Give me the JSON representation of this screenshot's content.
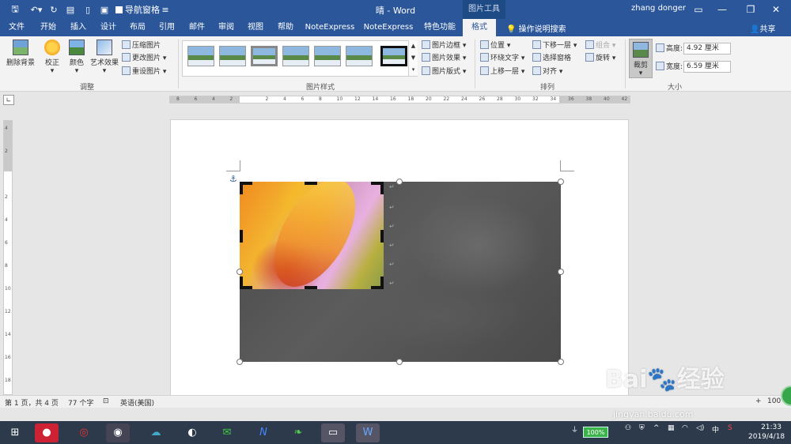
{
  "titlebar": {
    "nav_pane": "导航窗格",
    "title": "晴 - Word",
    "picture_tools": "图片工具",
    "user": "zhang donger"
  },
  "tabs": [
    "文件",
    "开始",
    "插入",
    "设计",
    "布局",
    "引用",
    "邮件",
    "审阅",
    "视图",
    "帮助",
    "NoteExpress",
    "NoteExpress",
    "特色功能",
    "格式"
  ],
  "tell_me": "操作说明搜索",
  "share": "共享",
  "ribbon": {
    "remove_bg": "删除背景",
    "correct": "校正",
    "color": "颜色",
    "art_effects": "艺术效果",
    "compress": "压缩图片",
    "change_pic": "更改图片",
    "reset_pic": "重设图片",
    "group_adjust": "调整",
    "border": "图片边框",
    "effects": "图片效果",
    "layout": "图片版式",
    "group_styles": "图片样式",
    "position": "位置",
    "wrap": "环绕文字",
    "bring_forward": "上移一层",
    "send_backward": "下移一层",
    "selection_pane": "选择窗格",
    "align": "对齐",
    "group": "组合",
    "rotate": "旋转",
    "group_arrange": "排列",
    "crop": "裁剪",
    "height_label": "高度:",
    "height_value": "4.92 厘米",
    "width_label": "宽度:",
    "width_value": "6.59 厘米",
    "group_size": "大小"
  },
  "ruler_h": [
    "8",
    "6",
    "4",
    "2",
    "",
    "2",
    "4",
    "6",
    "8",
    "10",
    "12",
    "14",
    "16",
    "18",
    "20",
    "22",
    "24",
    "26",
    "28",
    "30",
    "32",
    "34",
    "36",
    "38",
    "40",
    "42"
  ],
  "ruler_v": [
    "4",
    "2",
    "",
    "2",
    "4",
    "6",
    "8",
    "10",
    "12",
    "14",
    "16",
    "18"
  ],
  "status": {
    "pages": "第 1 页，共 4 页",
    "words": "77 个字",
    "language": "英语(美国)",
    "zoom": "100"
  },
  "taskbar": {
    "battery": "100%",
    "ime": "中",
    "time": "21:33",
    "date": "2019/4/18"
  },
  "watermark": {
    "brand": "Bai",
    "brand_cn": "经验",
    "url": "jingyan.baidu.com"
  },
  "colors": {
    "accent": "#2b579a",
    "taskbar": "#2c3a4c"
  }
}
